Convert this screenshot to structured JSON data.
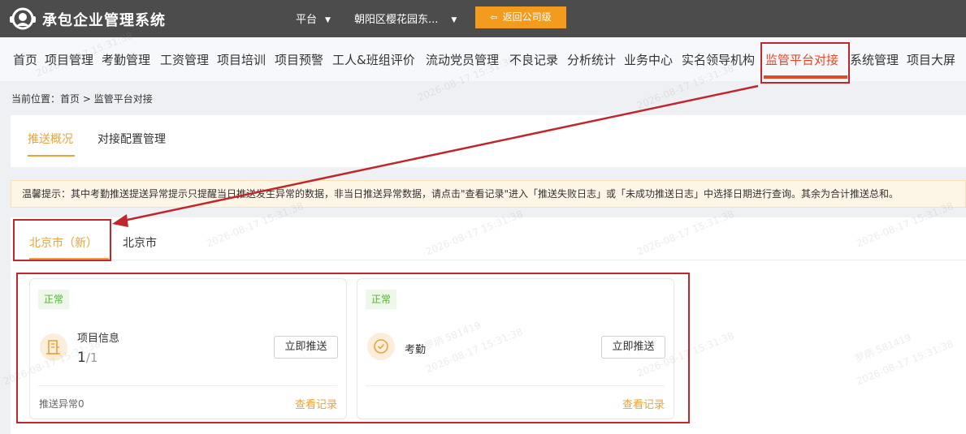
{
  "header": {
    "app_title": "承包企业管理系统",
    "platform_label": "平台",
    "project_label": "朝阳区樱花园东...",
    "back_button": "返回公司级"
  },
  "nav": {
    "items": [
      "首页",
      "项目管理",
      "考勤管理",
      "工资管理",
      "项目培训",
      "项目预警",
      "工人&班组评价",
      "流动党员管理",
      "不良记录",
      "分析统计",
      "业务中心",
      "实名领导机构",
      "监管平台对接",
      "系统管理",
      "项目大屏"
    ],
    "active": "监管平台对接"
  },
  "breadcrumb": {
    "prefix": "当前位置：",
    "home": "首页",
    "separator": ">",
    "current": "监管平台对接"
  },
  "subtabs": [
    "推送概况",
    "对接配置管理"
  ],
  "tip": "温馨提示：其中考勤推送提送异常提示只提醒当日推送发生异常的数据，非当日推送异常数据，请点击\"查看记录\"进入「推送失败日志」或「未成功推送日志」中选择日期进行查询。其余为合计推送总和。",
  "city_tabs": [
    "北京市（新）",
    "北京市"
  ],
  "cards": [
    {
      "status": "正常",
      "title": "项目信息",
      "count_num": "1",
      "count_den": "/1",
      "push_label": "立即推送",
      "foot_left": "推送异常0",
      "foot_right": "查看记录",
      "icon": "building-icon"
    },
    {
      "status": "正常",
      "title": "考勤",
      "push_label": "立即推送",
      "foot_right": "查看记录",
      "icon": "check-shield-icon"
    }
  ],
  "watermark": "2026-08-17 15:31:38",
  "watermark_name": "罗炳 581419",
  "colors": {
    "topbar": "#4c4c4c",
    "accent_orange": "#f39b1c",
    "nav_active": "#e24a24",
    "tab_active": "#e8a33a",
    "annotation_red": "#c0272d",
    "status_green": "#52b137"
  }
}
